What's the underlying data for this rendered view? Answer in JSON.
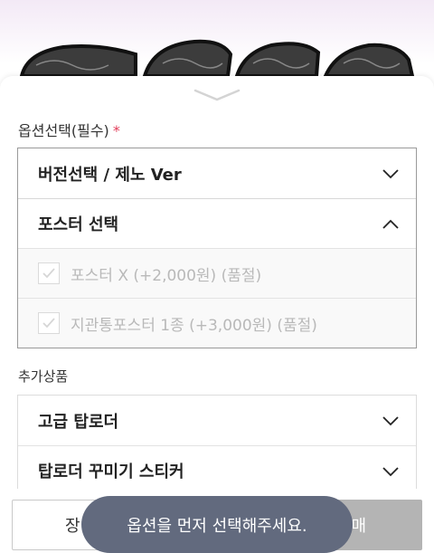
{
  "options": {
    "title": "옵션선택(필수)",
    "required_mark": "*",
    "version_select": {
      "label": "버전선택 / 제노 Ver",
      "icon": "chevron-down-icon"
    },
    "poster_select": {
      "label": "포스터 선택",
      "icon": "chevron-up-icon",
      "items": [
        {
          "label": "포스터 X (+2,000원) (품절)",
          "checked": true,
          "disabled": true
        },
        {
          "label": "지관통포스터 1종 (+3,000원) (품절)",
          "checked": true,
          "disabled": true
        }
      ]
    }
  },
  "additional": {
    "title": "추가상품",
    "items": [
      {
        "label": "고급 탑로더",
        "icon": "chevron-down-icon"
      },
      {
        "label": "탑로더 꾸미기 스티커",
        "icon": "chevron-down-icon"
      }
    ]
  },
  "bottom_bar": {
    "cart_label": "장",
    "buy_label": "매"
  },
  "toast": {
    "message": "옵션을 먼저 선택해주세요."
  },
  "colors": {
    "required": "#e23d5a",
    "toast_bg": "#626a7e",
    "buy_disabled": "#b4b4b4"
  }
}
